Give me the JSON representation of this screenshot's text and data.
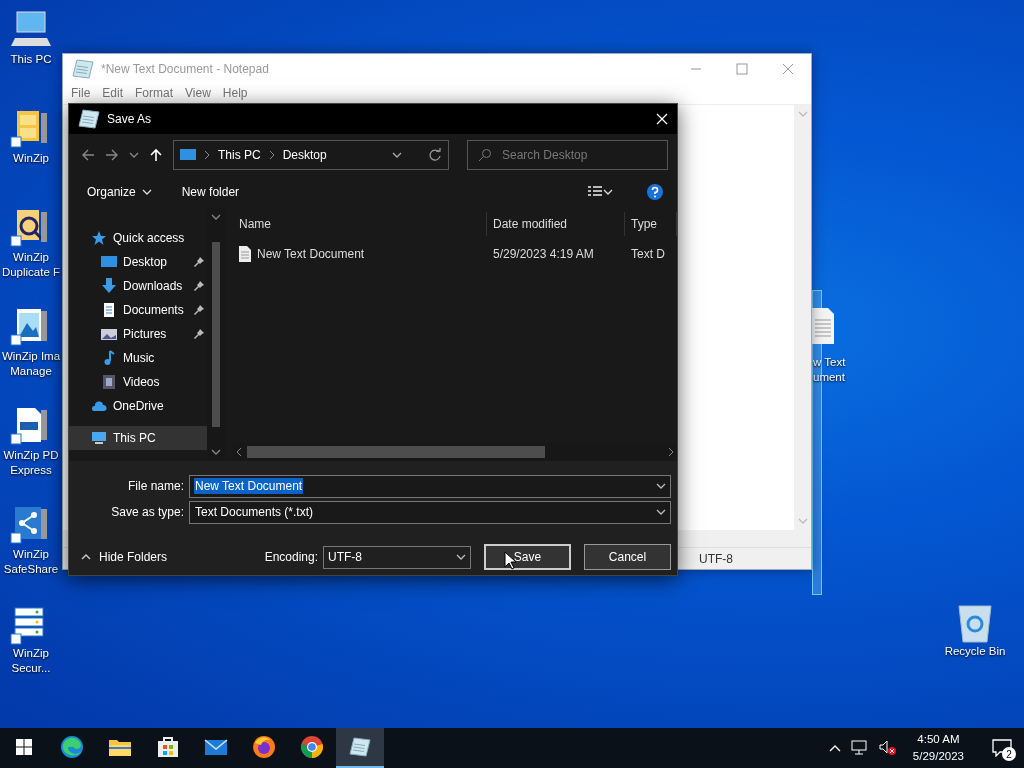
{
  "desktop_icons": [
    {
      "label": "This PC",
      "kind": "pc"
    },
    {
      "label": "WinZip",
      "kind": "winzip"
    },
    {
      "label": "WinZip Duplicate F",
      "kind": "duplicate"
    },
    {
      "label": "WinZip Ima Manage",
      "kind": "image"
    },
    {
      "label": "WinZip PD Express",
      "kind": "pdf"
    },
    {
      "label": "WinZip SafeShare",
      "kind": "share"
    },
    {
      "label": "WinZip Secur...",
      "kind": "secure"
    }
  ],
  "desktop_file": {
    "label": "w Text ument",
    "selected": true
  },
  "recycle_bin": {
    "label": "Recycle Bin"
  },
  "notepad": {
    "title": "*New Text Document - Notepad",
    "menu": [
      "File",
      "Edit",
      "Format",
      "View",
      "Help"
    ],
    "status": "UTF-8"
  },
  "dialog": {
    "title": "Save As",
    "path": [
      "This PC",
      "Desktop"
    ],
    "search": {
      "placeholder": "Search Desktop"
    },
    "toolbar": {
      "organize": "Organize",
      "new_folder": "New folder"
    },
    "nav": [
      {
        "label": "Quick access",
        "kind": "star",
        "selected": false,
        "children": [
          {
            "label": "Desktop",
            "kind": "desktop",
            "pinned": true,
            "selected": false
          },
          {
            "label": "Downloads",
            "kind": "download",
            "pinned": true,
            "selected": false
          },
          {
            "label": "Documents",
            "kind": "documents",
            "pinned": true,
            "selected": false
          },
          {
            "label": "Pictures",
            "kind": "pictures",
            "pinned": true,
            "selected": false
          },
          {
            "label": "Music",
            "kind": "music",
            "pinned": false,
            "selected": false
          },
          {
            "label": "Videos",
            "kind": "videos",
            "pinned": false,
            "selected": false
          }
        ]
      },
      {
        "label": "OneDrive",
        "kind": "cloud",
        "selected": false
      },
      {
        "label": "This PC",
        "kind": "pc",
        "selected": true
      }
    ],
    "columns": [
      "Name",
      "Date modified",
      "Type"
    ],
    "files": [
      {
        "name": "New Text Document",
        "date": "5/29/2023 4:19 AM",
        "type": "Text D"
      }
    ],
    "file_name": {
      "label": "File name:",
      "value": "New Text Document"
    },
    "save_type": {
      "label": "Save as type:",
      "value": "Text Documents (*.txt)"
    },
    "hide_folders": "Hide Folders",
    "encoding": {
      "label": "Encoding:",
      "value": "UTF-8"
    },
    "buttons": [
      {
        "label": "Save",
        "focused": true
      },
      {
        "label": "Cancel",
        "focused": false
      }
    ]
  },
  "taskbar": {
    "apps": [
      {
        "kind": "edge",
        "active": false
      },
      {
        "kind": "explorer",
        "active": false
      },
      {
        "kind": "store",
        "active": false
      },
      {
        "kind": "mail",
        "active": false
      },
      {
        "kind": "firefox",
        "active": false
      },
      {
        "kind": "chrome",
        "active": false
      },
      {
        "kind": "notepad",
        "active": true
      }
    ],
    "time": "4:50 AM",
    "date": "5/29/2023",
    "notifications": "2"
  }
}
